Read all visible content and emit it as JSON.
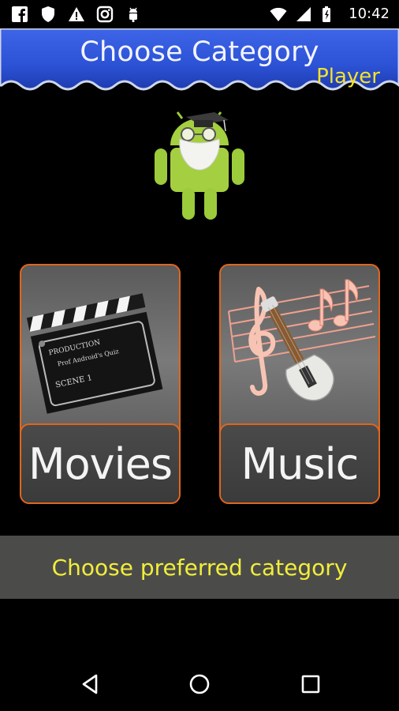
{
  "status_bar": {
    "time": "10:42",
    "left_icons": [
      "facebook-icon",
      "shield-icon",
      "warning-icon",
      "instagram-icon",
      "android-debug-icon"
    ],
    "right_icons": [
      "wifi-icon",
      "cell-signal-icon",
      "battery-icon"
    ]
  },
  "header": {
    "title": "Choose Category",
    "subtitle": "Player",
    "background_color": "#2f55d8",
    "subtitle_color": "#f3e22a"
  },
  "mascot": {
    "icon": "android-professor-icon"
  },
  "categories": [
    {
      "label": "Movies",
      "art": "clapperboard-icon",
      "art_text": [
        "PRODUCTION",
        "Prof Android's Quiz",
        "SCENE  1"
      ]
    },
    {
      "label": "Music",
      "art": "music-notes-guitar-icon"
    }
  ],
  "hint": {
    "text": "Choose preferred category",
    "color": "#f2ee3a"
  },
  "navigation": {
    "icons": [
      "back-icon",
      "home-icon",
      "recents-icon"
    ]
  },
  "accent_color": "#e0661c"
}
